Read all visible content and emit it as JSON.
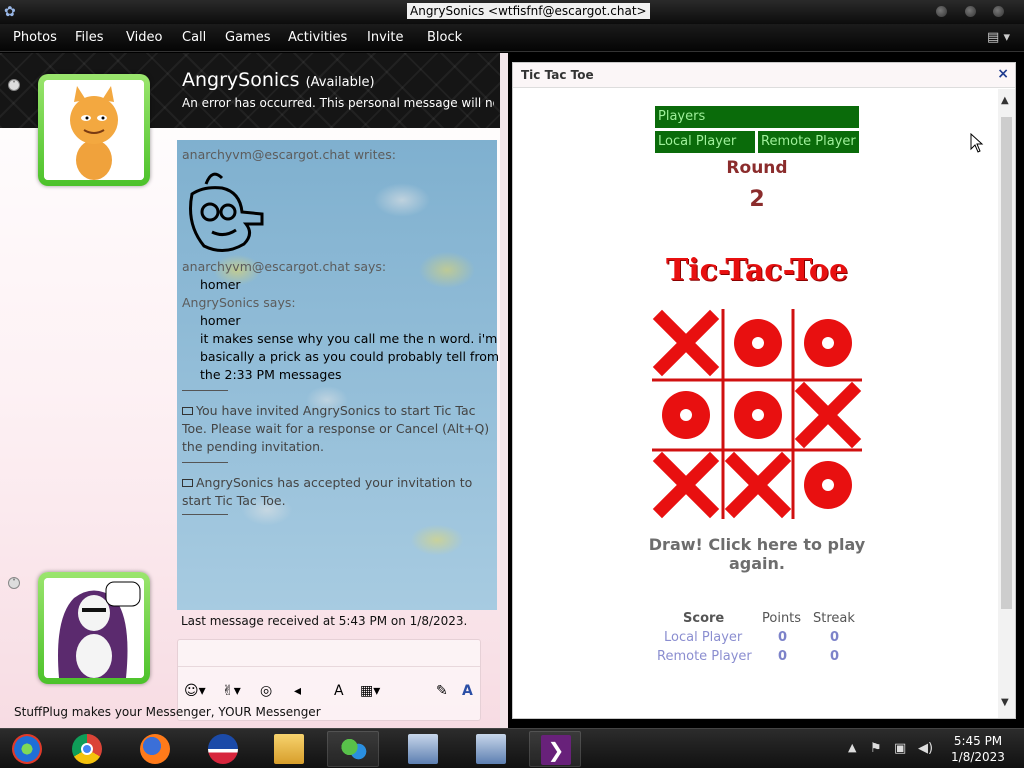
{
  "window": {
    "title": "AngrySonics <wtfisfnf@escargot.chat>"
  },
  "menu": {
    "items": [
      "Photos",
      "Files",
      "Video",
      "Call",
      "Games",
      "Activities",
      "Invite",
      "Block"
    ]
  },
  "contact": {
    "name": "AngrySonics",
    "status": "(Available)",
    "personal_message": "An error has occurred. This personal message will not..."
  },
  "chat": {
    "lines": [
      "anarchyvm@escargot.chat writes:",
      "anarchyvm@escargot.chat says:",
      "homer",
      "AngrySonics says:",
      "homer",
      "it makes sense why you call me the n word. i'm",
      "basically a prick as you could probably tell from",
      "the 2:33 PM messages"
    ],
    "invite_msg": [
      "You have invited AngrySonics to start Tic Tac",
      "Toe. Please wait for a response or Cancel (Alt+Q)",
      "the pending invitation."
    ],
    "accepted_msg": [
      "AngrySonics has accepted your invitation to",
      "start Tic Tac Toe."
    ],
    "last_received": "Last message received at 5:43 PM on 1/8/2023."
  },
  "footer": {
    "text": "StuffPlug makes your Messenger, YOUR Messenger"
  },
  "game": {
    "window_title": "Tic Tac Toe",
    "close": "×",
    "players_label": "Players",
    "local_player": "Local Player",
    "remote_player": "Remote Player",
    "round_label": "Round",
    "round_number": "2",
    "logo_text": "Tic-Tac-Toe",
    "board": [
      "X",
      "O",
      "O",
      "O",
      "O",
      "X",
      "X",
      "X",
      "O"
    ],
    "result": "Draw! Click here to play again.",
    "score": {
      "header": [
        "Score",
        "Points",
        "Streak"
      ],
      "rows": [
        {
          "name": "Local Player",
          "points": "0",
          "streak": "0"
        },
        {
          "name": "Remote Player",
          "points": "0",
          "streak": "0"
        }
      ]
    }
  },
  "taskbar": {
    "icons": [
      "windows-media-center-icon",
      "chrome-icon",
      "firefox-icon",
      "obama-logo-icon",
      "file-explorer-icon",
      "msn-messenger-icon",
      "remote-desktop-icon",
      "remote-desktop-icon-2",
      "visual-studio-icon"
    ],
    "time": "5:45 PM",
    "date": "1/8/2023"
  },
  "colors": {
    "players_green": "#0a6b0a",
    "round_color": "#8b2c2c",
    "mark_red": "#e81010"
  }
}
